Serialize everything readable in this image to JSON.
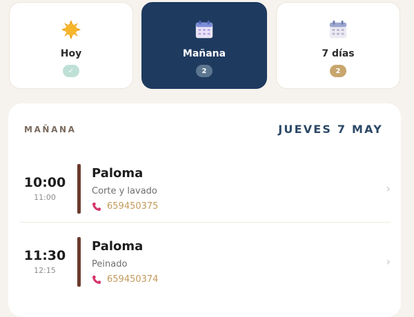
{
  "tabs": [
    {
      "label": "Hoy",
      "badge": "✓",
      "icon": "sun-icon"
    },
    {
      "label": "Mañana",
      "badge": "2",
      "icon": "calendar-icon"
    },
    {
      "label": "7 días",
      "badge": "2",
      "icon": "calendar-week-icon"
    }
  ],
  "active_tab": "Mañana",
  "schedule": {
    "section_label": "MAÑANA",
    "date_label": "JUEVES 7 MAY",
    "appointments": [
      {
        "time": "10:00",
        "end_time": "11:00",
        "client": "Paloma",
        "service": "Corte y lavado",
        "phone": "659450375"
      },
      {
        "time": "11:30",
        "end_time": "12:15",
        "client": "Paloma",
        "service": "Peinado",
        "phone": "659450374"
      }
    ]
  },
  "colors": {
    "background": "#f6f2ed",
    "active_tab": "#1e3a5f",
    "accent_bar": "#6b3a2e",
    "phone_text": "#c39a5c",
    "phone_icon": "#d6336c",
    "badge_check": "#bfe0d6",
    "badge_gold": "#c8a66e"
  }
}
